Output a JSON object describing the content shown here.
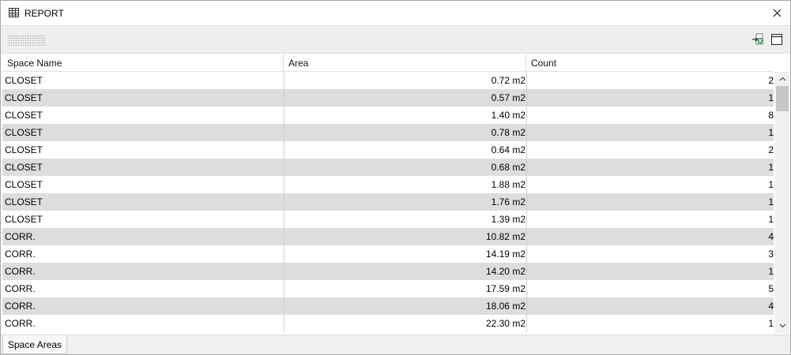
{
  "window": {
    "title": "REPORT",
    "icons": {
      "title": "table-icon",
      "close": "close-icon"
    }
  },
  "toolbar": {
    "icons": {
      "export": "export-excel-icon",
      "layout": "window-layout-icon"
    }
  },
  "table": {
    "columns": [
      "Space Name",
      "Area",
      "Count"
    ],
    "rows": [
      [
        "CLOSET",
        "0.72 m2",
        "2"
      ],
      [
        "CLOSET",
        "0.57 m2",
        "1"
      ],
      [
        "CLOSET",
        "1.40 m2",
        "8"
      ],
      [
        "CLOSET",
        "0.78 m2",
        "1"
      ],
      [
        "CLOSET",
        "0.64 m2",
        "2"
      ],
      [
        "CLOSET",
        "0.68 m2",
        "1"
      ],
      [
        "CLOSET",
        "1.88 m2",
        "1"
      ],
      [
        "CLOSET",
        "1.76 m2",
        "1"
      ],
      [
        "CLOSET",
        "1.39 m2",
        "1"
      ],
      [
        "CORR.",
        "10.82 m2",
        "4"
      ],
      [
        "CORR.",
        "14.19 m2",
        "3"
      ],
      [
        "CORR.",
        "14.20 m2",
        "1"
      ],
      [
        "CORR.",
        "17.59 m2",
        "5"
      ],
      [
        "CORR.",
        "18.06 m2",
        "4"
      ],
      [
        "CORR.",
        "22.30 m2",
        "1"
      ]
    ]
  },
  "scrollbar": {
    "icons": {
      "up": "chevron-up-icon",
      "down": "chevron-down-icon"
    }
  },
  "tabs": [
    {
      "label": "Space Areas"
    }
  ]
}
